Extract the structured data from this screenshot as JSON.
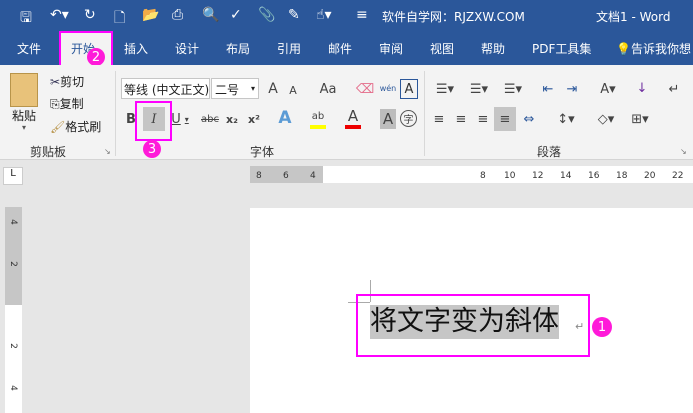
{
  "titlebar": {
    "site": "软件自学网：RJZXW.COM",
    "doc": "文档1",
    "sep": "-",
    "app": "Word"
  },
  "tabs": [
    "文件",
    "开始",
    "插入",
    "设计",
    "布局",
    "引用",
    "邮件",
    "审阅",
    "视图",
    "帮助",
    "PDF工具集"
  ],
  "tell_me": "告诉我你想",
  "clipboard": {
    "paste": "粘贴",
    "cut": "剪切",
    "copy": "复制",
    "format_painter": "格式刷",
    "label": "剪贴板"
  },
  "font": {
    "name": "等线 (中文正文)",
    "size": "二号",
    "label": "字体",
    "bold": "B",
    "italic": "I",
    "underline": "U",
    "strike": "abc",
    "sub": "x₂",
    "sup": "x²",
    "grow": "A",
    "shrink": "A",
    "case": "Aa",
    "phonetic": "wén",
    "border_char": "A",
    "effects": "A",
    "highlight": "ab",
    "color": "A",
    "shade": "A",
    "enclose": "字"
  },
  "paragraph": {
    "label": "段落"
  },
  "ruler": {
    "corner": "L",
    "left": [
      "8",
      "6",
      "4"
    ],
    "right": [
      "8",
      "10",
      "12",
      "14",
      "16",
      "18",
      "20",
      "22"
    ],
    "vertical": [
      "4",
      "2",
      "2",
      "4"
    ]
  },
  "document": {
    "text": "将文字变为斜体",
    "mark": "↵"
  },
  "badges": [
    "1",
    "2",
    "3"
  ]
}
